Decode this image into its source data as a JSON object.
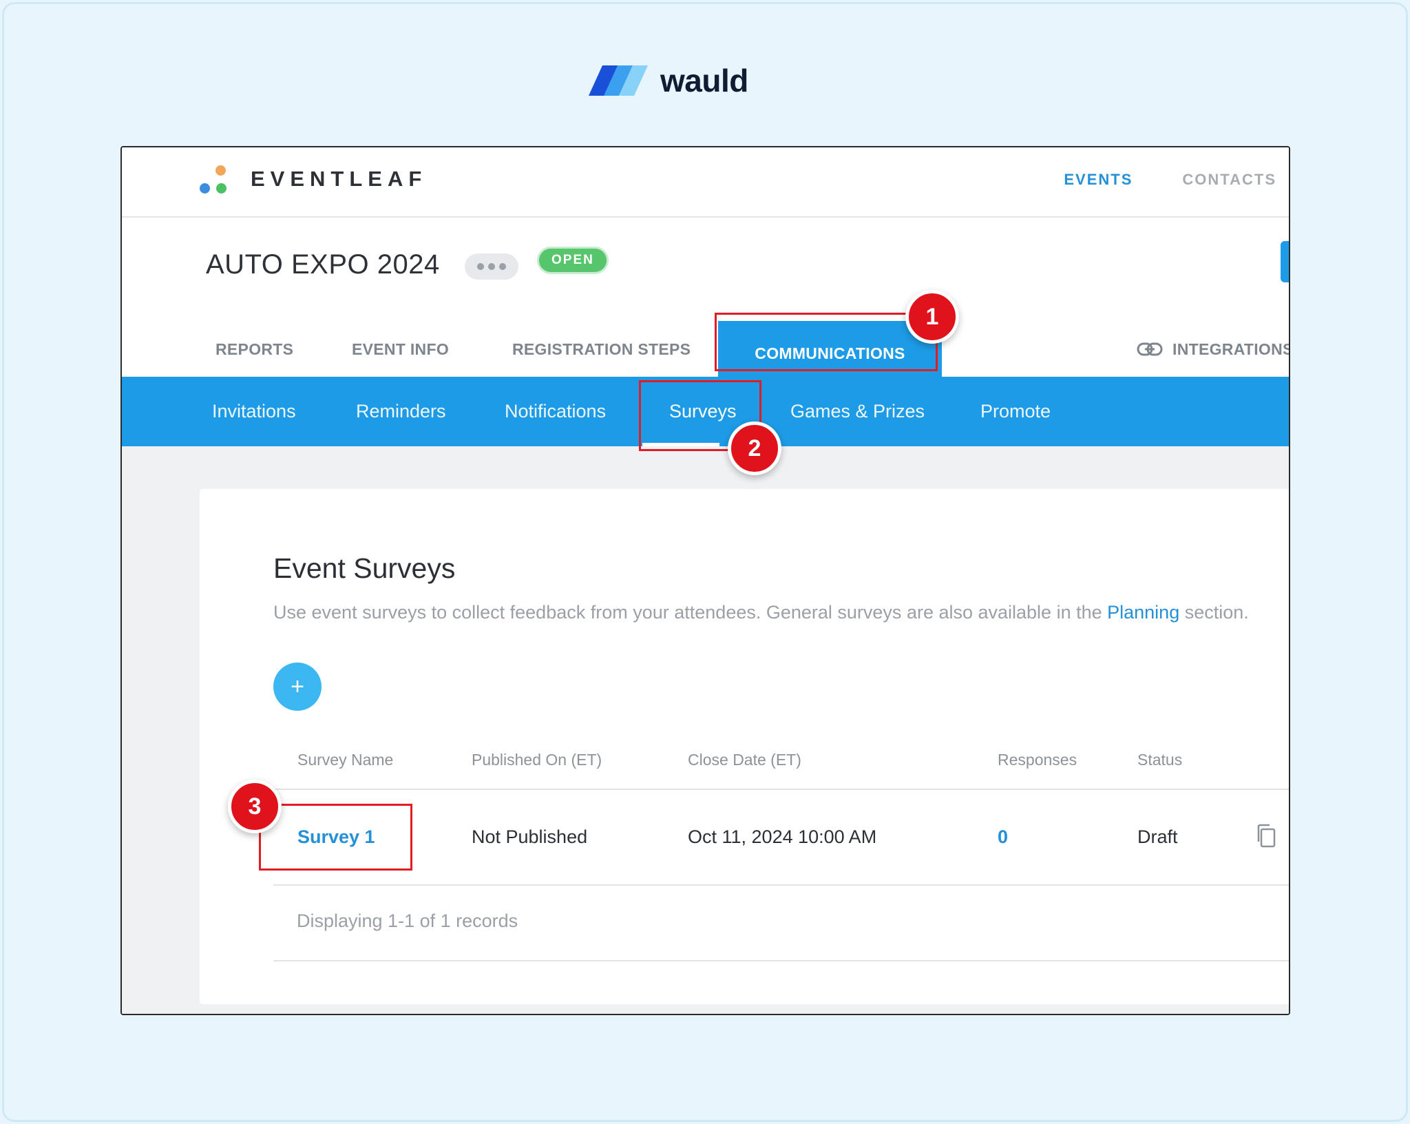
{
  "brand": {
    "name": "wauld"
  },
  "app": {
    "logo_text": "EVENTLEAF",
    "top_nav": [
      "EVENTS",
      "CONTACTS"
    ]
  },
  "event": {
    "title": "AUTO EXPO 2024",
    "status_badge": "OPEN"
  },
  "main_tabs": [
    "REPORTS",
    "EVENT INFO",
    "REGISTRATION STEPS",
    "COMMUNICATIONS",
    "INTEGRATIONS"
  ],
  "sub_tabs": [
    "Invitations",
    "Reminders",
    "Notifications",
    "Surveys",
    "Games & Prizes",
    "Promote"
  ],
  "surveys": {
    "title": "Event Surveys",
    "description": "Use event surveys to collect feedback from your attendees. General surveys are also available in the ",
    "description_link": "Planning",
    "description_tail": " section.",
    "add_button": "+",
    "columns": [
      "Survey Name",
      "Published On (ET)",
      "Close Date (ET)",
      "Responses",
      "Status"
    ],
    "rows": [
      {
        "name": "Survey 1",
        "published": "Not Published",
        "close_date": "Oct 11, 2024 10:00 AM",
        "responses": "0",
        "status": "Draft"
      }
    ],
    "pager": "Displaying 1-1 of 1 records"
  },
  "annotations": [
    "1",
    "2",
    "3"
  ],
  "colors": {
    "primary": "#1e9be6",
    "link": "#2490d7",
    "open_badge": "#57c56b",
    "annotation": "#e0121c"
  }
}
